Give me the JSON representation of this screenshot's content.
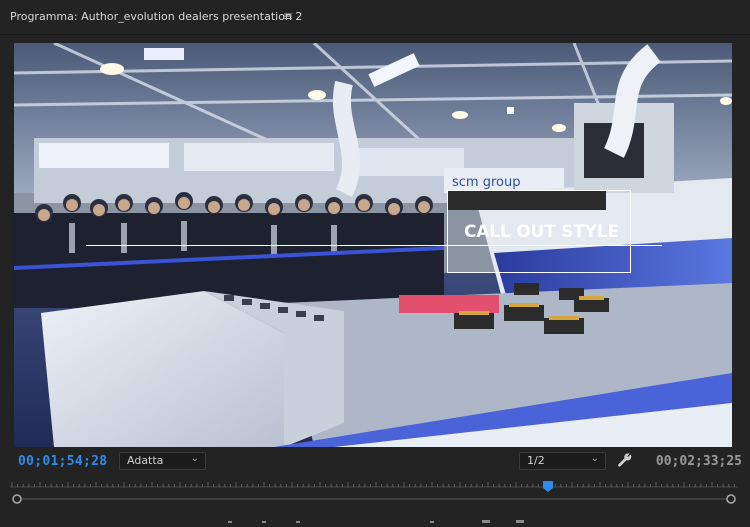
{
  "panel": {
    "title": "Programma: Author_evolution dealers presentation 2",
    "menu_icon": "hamburger-menu-icon"
  },
  "viewer": {
    "overlay_text": "CALL OUT STYLE"
  },
  "controls": {
    "current_timecode": "00;01;54;28",
    "zoom_select": "Adatta",
    "resolution_select": "1/2",
    "settings_icon": "wrench-icon",
    "duration_timecode": "00;02;33;25"
  },
  "colors": {
    "accent": "#2d8ceb",
    "background": "#232323"
  }
}
